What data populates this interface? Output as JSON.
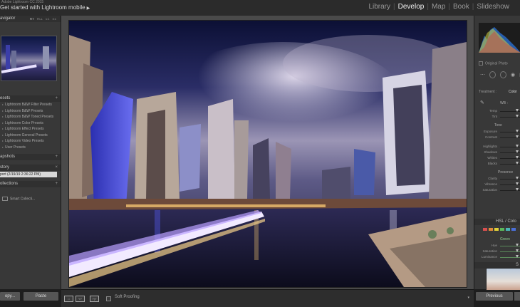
{
  "app": {
    "version_line": "Adobe Lightroom CC 2015",
    "identity_text": "Get started with Lightroom mobile",
    "identity_arrow": "▶"
  },
  "modules": [
    "Library",
    "Develop",
    "Map",
    "Book",
    "Slideshow"
  ],
  "module_separators": [
    "|",
    "|",
    "|",
    "|"
  ],
  "active_module": "Develop",
  "left_panel": {
    "navigator": {
      "title": "avigator",
      "modes": [
        "FIT",
        "FILL",
        "1:1",
        "3:1"
      ]
    },
    "presets": {
      "title": "esets",
      "plus": "+",
      "items": [
        "Lightroom B&W Filter Presets",
        "Lightroom B&W Presets",
        "Lightroom B&W Toned Presets",
        "Lightroom Color Presets",
        "Lightroom Effect Presets",
        "Lightroom General Presets",
        "Lightroom Video Presets",
        "User Presets"
      ]
    },
    "snapshots": {
      "title": "apshots",
      "plus": "+"
    },
    "history": {
      "title": "story",
      "plus": "×",
      "item": "port (2/19/19 2:36:22 PM)"
    },
    "collections": {
      "title": "ollections",
      "plus": "+",
      "item": "Smart Collecti..."
    },
    "copy_label": "opy...",
    "paste_label": "Paste"
  },
  "toolbar": {
    "soft_proofing_label": "Soft Proofing",
    "view_icons": [
      "□",
      "YY",
      "Y|Y"
    ],
    "dropdown": "▾"
  },
  "right_panel": {
    "original_photo_label": "Original Photo",
    "treatment_label": "Treatment :",
    "treatment_value": "Color",
    "wb_label": "WB :",
    "wb_sliders": [
      "Temp",
      "Tint"
    ],
    "tone_label": "Tone",
    "tone_auto": "Auto",
    "tone_sliders": [
      "Exposure",
      "Contrast",
      "Highlights",
      "Shadows",
      "Whites",
      "Blacks"
    ],
    "presence_label": "Presence",
    "presence_sliders": [
      "Clarity",
      "Vibrance",
      "Saturation"
    ],
    "hsl_title": "HSL / Colo",
    "hsl_active_color": "Green",
    "hsl_sliders": [
      "Hue",
      "Saturation",
      "Luminance"
    ],
    "split_title": "S",
    "previous_label": "Previous"
  },
  "colors": {
    "accent_active": "#f0f0f0",
    "panel_bg": "#383838",
    "center_bg": "#4a4a4a",
    "swatches": [
      "#d94f4f",
      "#e08a3a",
      "#e0d23a",
      "#5ab85a",
      "#4ab5b5",
      "#4a6fd8",
      "#9a5ad8",
      "#d85aa8"
    ]
  }
}
